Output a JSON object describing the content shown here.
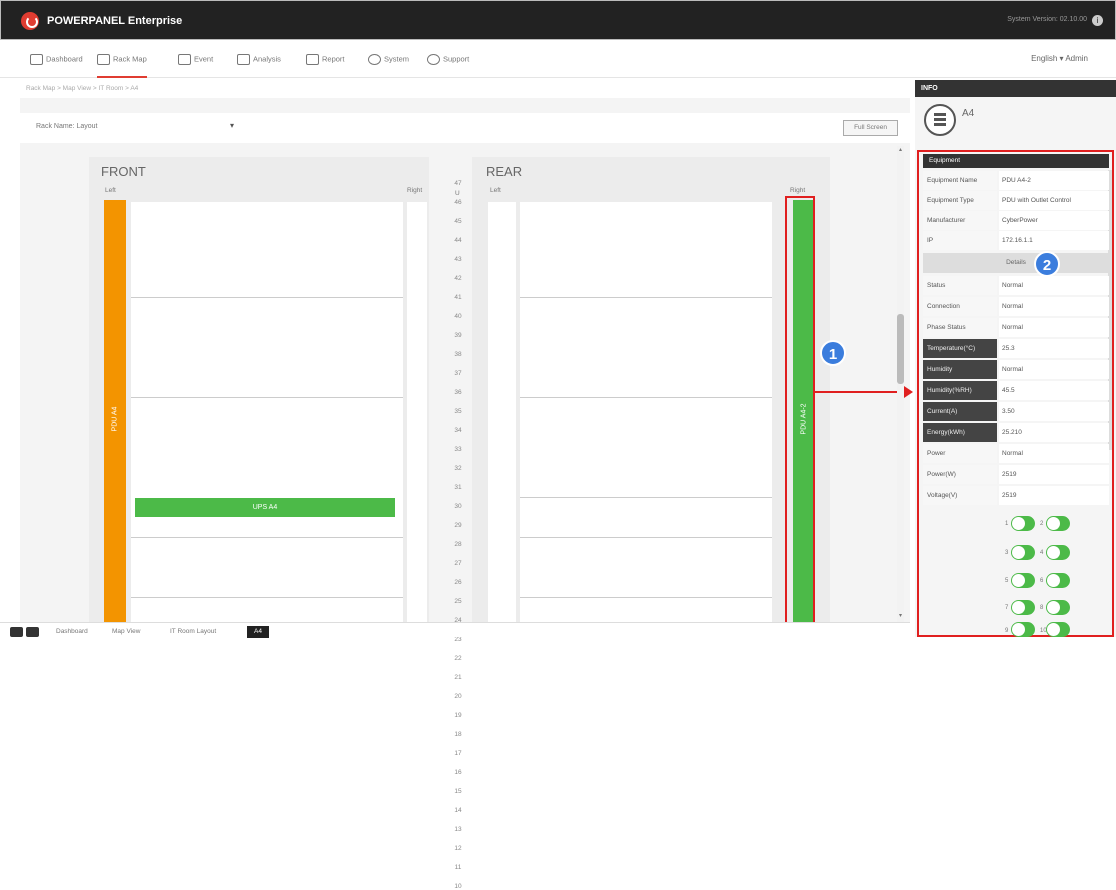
{
  "titlebar": {
    "app_title": "POWERPANEL Enterprise",
    "right_text": "System Version: 02.10.00",
    "info_icon": "i"
  },
  "nav": {
    "items": [
      {
        "label": "Dashboard",
        "icon": "cloud-icon"
      },
      {
        "label": "Rack Map",
        "icon": "rack-icon"
      },
      {
        "label": "Event",
        "icon": "event-icon"
      },
      {
        "label": "Analysis",
        "icon": "chart-icon"
      },
      {
        "label": "Report",
        "icon": "report-icon"
      },
      {
        "label": "System",
        "icon": "gear-icon"
      },
      {
        "label": "Support",
        "icon": "help-icon"
      }
    ],
    "user": "English ▾  Admin"
  },
  "breadcrumb": "Rack Map > Map View > IT Room > A4",
  "toolbar": {
    "select_label": "Rack Name: Layout",
    "screen_button": "Full Screen"
  },
  "rack": {
    "front_title": "FRONT",
    "rear_title": "REAR",
    "left_label": "Left",
    "right_label": "Right",
    "u_label": "U",
    "units": [
      "47",
      "46",
      "45",
      "44",
      "43",
      "42",
      "41",
      "40",
      "39",
      "38",
      "37",
      "36",
      "35",
      "34",
      "33",
      "32",
      "31",
      "30",
      "29",
      "28",
      "27",
      "26",
      "25",
      "24",
      "23",
      "22",
      "21",
      "20",
      "19",
      "18",
      "17",
      "16",
      "15",
      "14",
      "13",
      "12",
      "11",
      "10"
    ],
    "front_pdu_label": "PDU A4",
    "rear_pdu_label": "PDU A4-2",
    "hbar_label": "UPS A4"
  },
  "footer": {
    "tabs": [
      "Dashboard",
      "Map View",
      "IT Room Layout"
    ],
    "active": "A4"
  },
  "side": {
    "header": "INFO",
    "id": "A4",
    "equipment_header": "Equipment",
    "rows": [
      {
        "k": "Equipment Name",
        "v": "PDU A4-2"
      },
      {
        "k": "Equipment Type",
        "v": "PDU with Outlet Control"
      },
      {
        "k": "Manufacturer",
        "v": "CyberPower"
      },
      {
        "k": "IP",
        "v": "172.16.1.1"
      }
    ],
    "action": "Details",
    "status_rows": [
      {
        "k": "Status",
        "v": "Normal"
      },
      {
        "k": "Connection",
        "v": "Normal"
      },
      {
        "k": "Phase Status",
        "v": "Normal"
      },
      {
        "k": "Temperature(°C)",
        "v": "25.3"
      },
      {
        "k": "Humidity",
        "v": "Normal"
      },
      {
        "k": "Humidity(%RH)",
        "v": "45.5"
      },
      {
        "k": "Current(A)",
        "v": "3.50"
      },
      {
        "k": "Energy(kWh)",
        "v": "25.210"
      },
      {
        "k": "Power",
        "v": "Normal"
      },
      {
        "k": "Power(W)",
        "v": "2519"
      },
      {
        "k": "Voltage(V)",
        "v": "2519"
      }
    ],
    "toggles": [
      {
        "a": "1",
        "b": "2"
      },
      {
        "a": "3",
        "b": "4"
      },
      {
        "a": "5",
        "b": "6"
      },
      {
        "a": "7",
        "b": "8"
      },
      {
        "a": "9",
        "b": "10"
      }
    ]
  },
  "callouts": {
    "one": "1",
    "two": "2"
  }
}
